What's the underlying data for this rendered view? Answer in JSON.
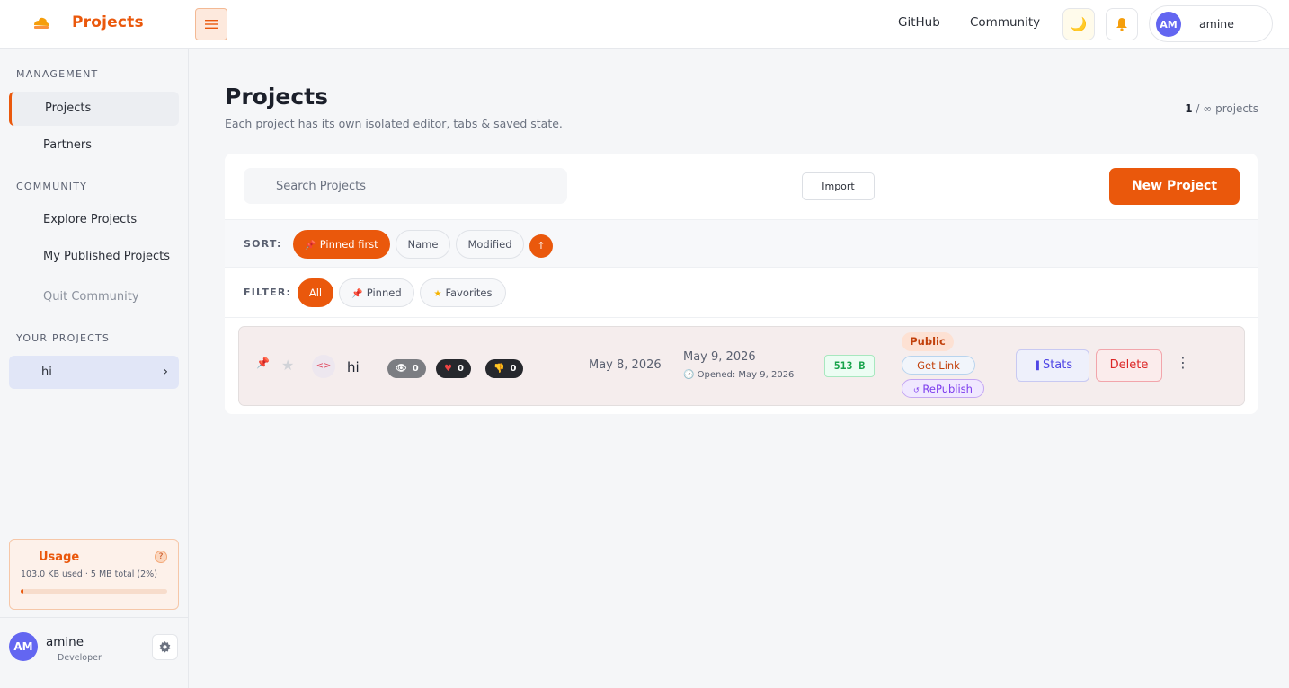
{
  "header": {
    "brand": "Projects",
    "links": [
      "GitHub",
      "Community"
    ],
    "theme_icon": "moon-icon",
    "bell_icon": "bell-icon",
    "user": {
      "initials": "AM",
      "name": "amine"
    }
  },
  "sidebar": {
    "sections": {
      "management": "MANAGEMENT",
      "community": "COMMUNITY",
      "your_projects": "YOUR PROJECTS"
    },
    "management_items": [
      "Projects",
      "Partners"
    ],
    "community_items": [
      "Explore Projects",
      "My Published Projects",
      "Quit Community"
    ],
    "project_items": [
      "hi"
    ],
    "usage": {
      "title": "Usage",
      "help": "?",
      "detail": "103.0 KB used · 5 MB total (2%)",
      "percent": 2
    },
    "user": {
      "initials": "AM",
      "name": "amine",
      "role": "Developer"
    }
  },
  "page": {
    "title": "Projects",
    "subtitle": "Each project has its own isolated editor, tabs & saved state.",
    "count_value": "1",
    "count_suffix": "/ ∞ projects"
  },
  "toolbar": {
    "search_placeholder": "Search Projects",
    "import_label": "Import",
    "new_project_label": "New Project"
  },
  "sort": {
    "label": "SORT:",
    "options": [
      "Pinned first",
      "Name",
      "Modified"
    ],
    "active": "Pinned first",
    "direction": "↑"
  },
  "filter": {
    "label": "FILTER:",
    "options": [
      "All",
      "Pinned",
      "Favorites"
    ],
    "active": "All"
  },
  "projects": [
    {
      "name": "hi",
      "views": "0",
      "likes": "0",
      "dislikes": "0",
      "created": "May 8, 2026",
      "modified": "May 9, 2026",
      "opened": "Opened: May 9, 2026",
      "size": "513 B",
      "visibility": "Public",
      "get_link": "Get Link",
      "republish": "RePublish",
      "stats": "Stats",
      "delete": "Delete"
    }
  ],
  "colors": {
    "accent": "#ea580c",
    "avatar": "#6366f1",
    "stats": "#4f46e5",
    "danger": "#dc2626",
    "success": "#16a34a"
  }
}
